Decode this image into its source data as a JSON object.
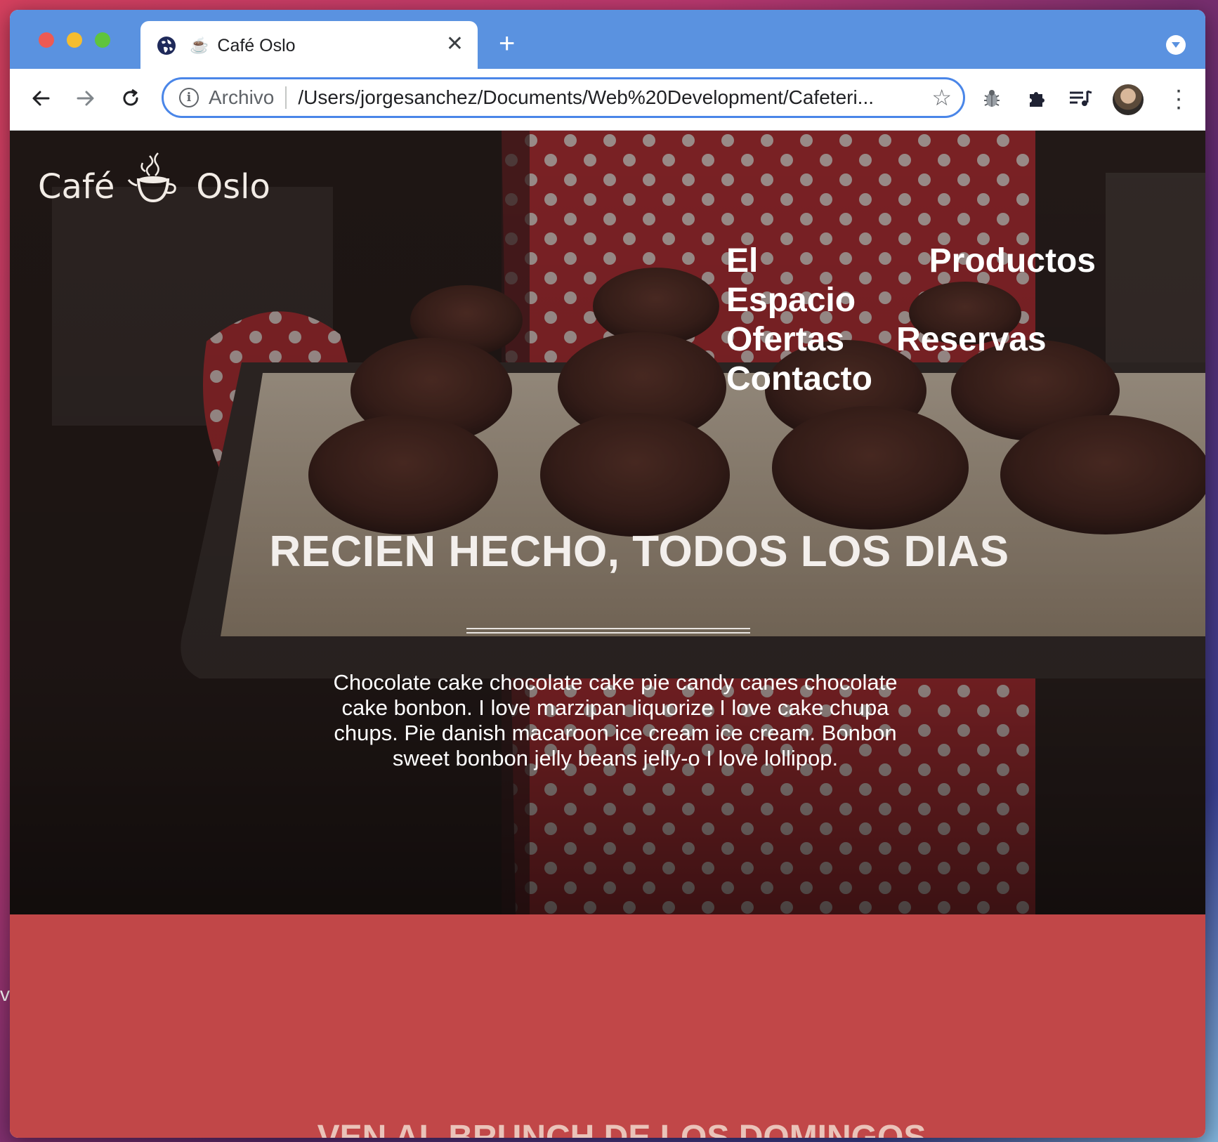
{
  "browser": {
    "tab_title": "Café Oslo",
    "tab_favicon": "☕",
    "url_scheme_label": "Archivo",
    "url": "/Users/jorgesanchez/Documents/Web%20Development/Cafeteri...",
    "new_tab_glyph": "+",
    "close_glyph": "✕"
  },
  "site": {
    "logo_left": "Café",
    "logo_right": "Oslo",
    "nav": [
      "El Espacio",
      "Productos",
      "Ofertas",
      "Reservas",
      "Contacto"
    ],
    "headline": "RECIEN HECHO, TODOS LOS DIAS",
    "hero_text": "Chocolate cake chocolate cake pie candy canes chocolate cake bonbon. I love marzipan liquorize I love cake chupa chups. Pie danish macaroon ice cream ice cream. Bonbon sweet bonbon jelly beans jelly-o I love lollipop.",
    "brunch_title": "VEN AL BRUNCH DE LOS DOMINGOS"
  },
  "desktop": {
    "edge_letter": "v"
  },
  "colors": {
    "tabstrip": "#5a92e0",
    "brunch_band": "#c14748",
    "omnibox_border": "#4a86e8"
  },
  "icons": [
    "globe-icon",
    "back-arrow-icon",
    "forward-arrow-icon",
    "reload-icon",
    "info-icon",
    "star-icon",
    "bug-icon",
    "puzzle-icon",
    "media-queue-icon",
    "kebab-menu-icon",
    "tab-search-icon"
  ]
}
